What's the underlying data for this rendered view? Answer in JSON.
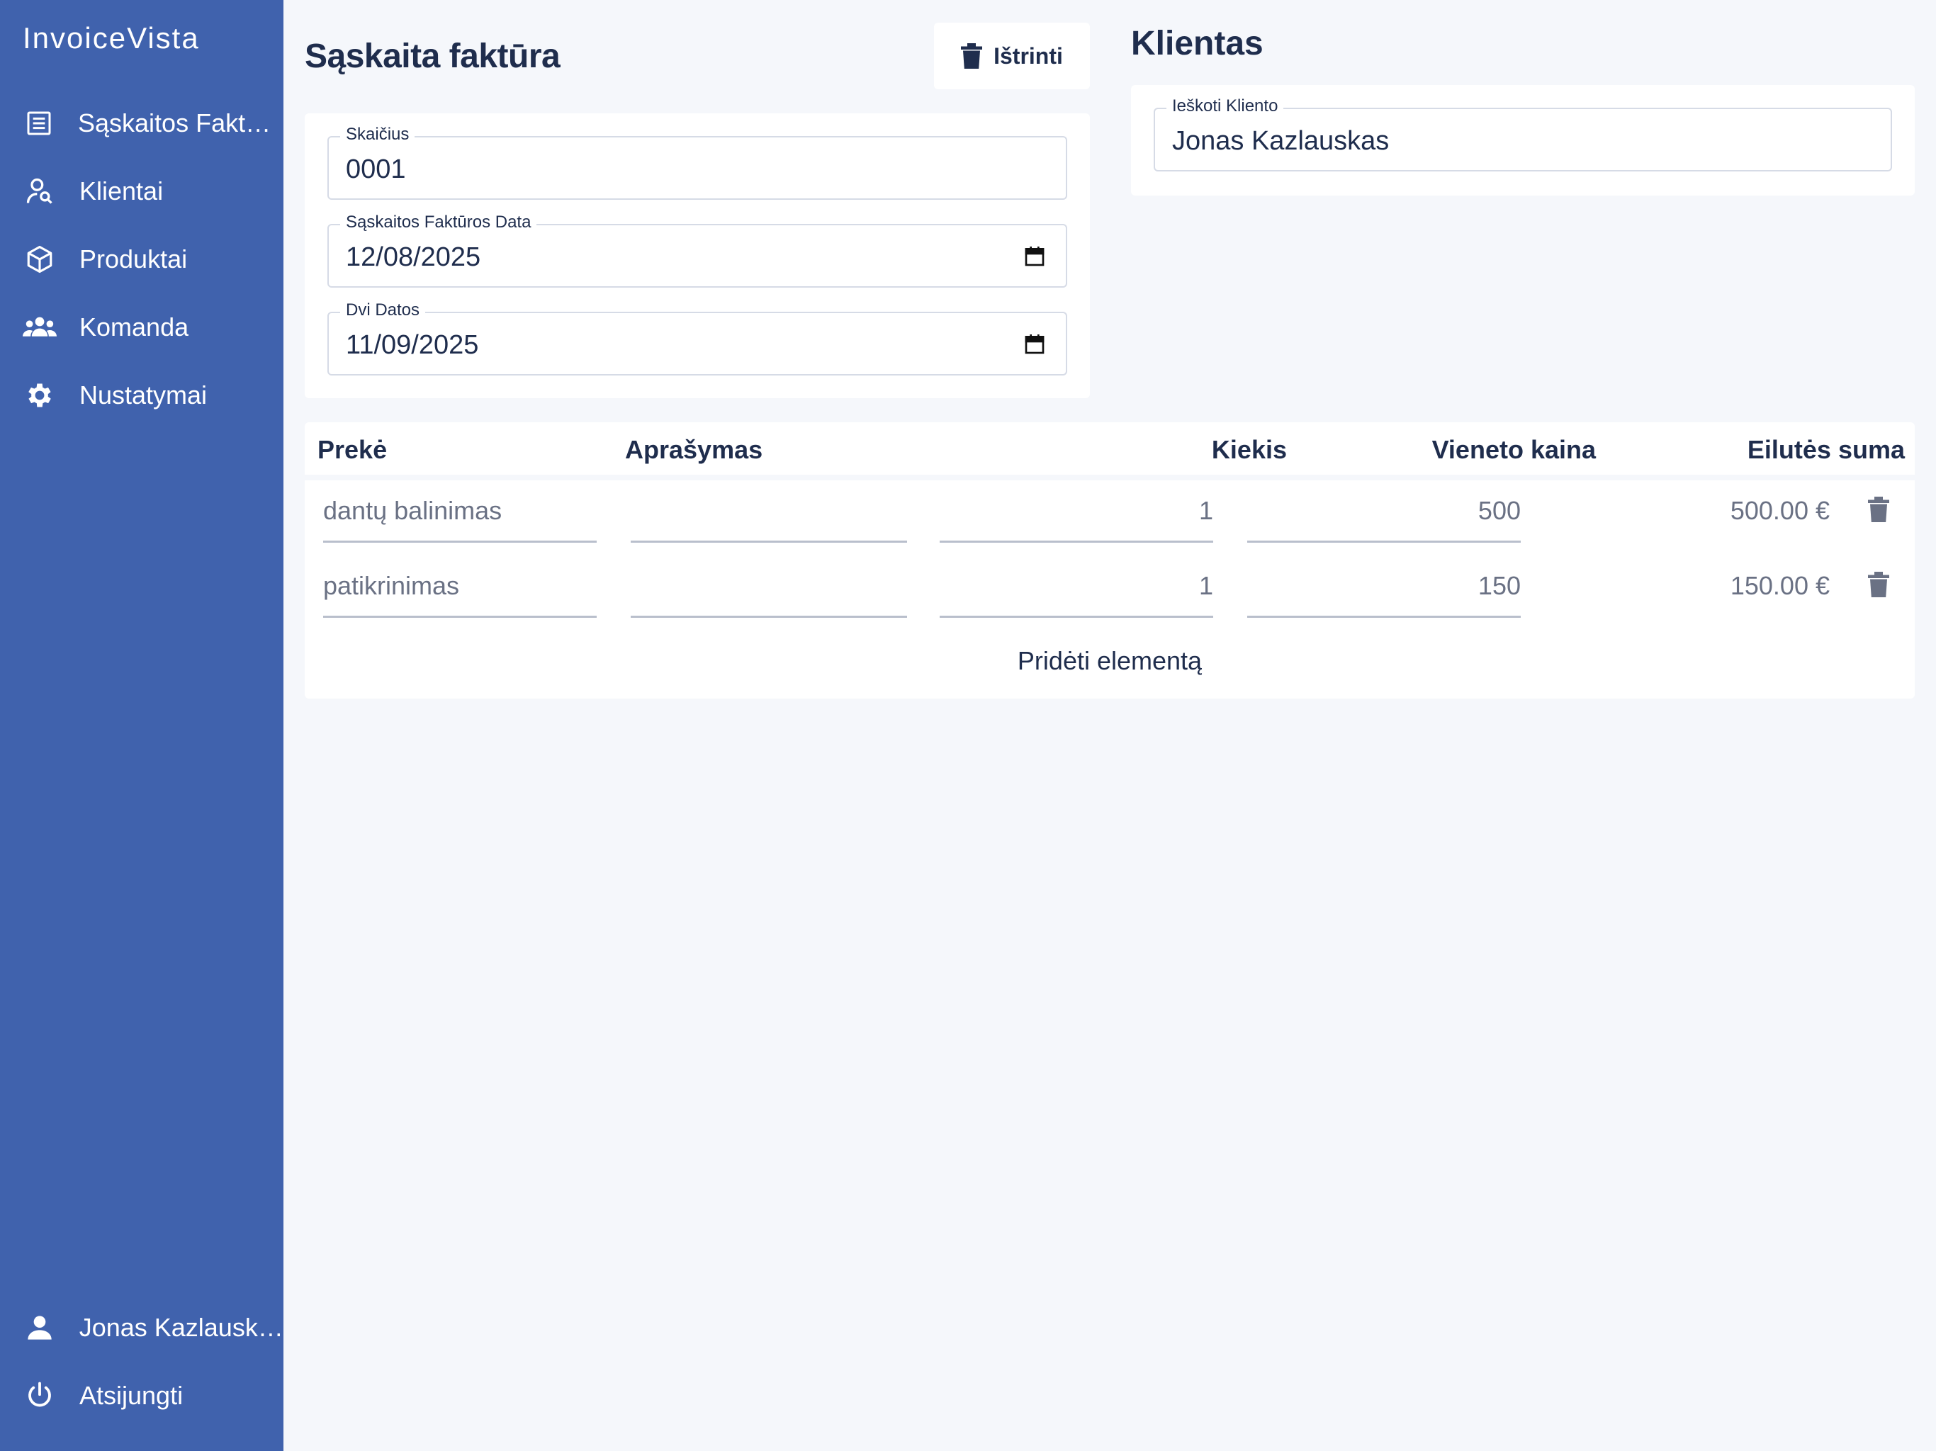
{
  "app": {
    "brand": "InvoiceVista"
  },
  "sidebar": {
    "items": [
      {
        "label": "Sąskaitos Faktūros",
        "icon": "receipt-icon"
      },
      {
        "label": "Klientai",
        "icon": "user-search-icon"
      },
      {
        "label": "Produktai",
        "icon": "cube-icon"
      },
      {
        "label": "Komanda",
        "icon": "users-icon"
      },
      {
        "label": "Nustatymai",
        "icon": "gear-icon"
      }
    ],
    "bottom": [
      {
        "label": "Jonas Kazlauskas",
        "icon": "user-icon"
      },
      {
        "label": "Atsijungti",
        "icon": "power-icon"
      }
    ]
  },
  "invoice": {
    "title": "Sąskaita faktūra",
    "delete_label": "Ištrinti",
    "number_label": "Skaičius",
    "number_value": "0001",
    "date_label": "Sąskaitos Faktūros Data",
    "date_value": "12/08/2025",
    "due_label": "Dvi Datos",
    "due_value": "11/09/2025"
  },
  "client": {
    "title": "Klientas",
    "search_label": "Ieškoti Kliento",
    "search_value": "Jonas Kazlauskas"
  },
  "items": {
    "headers": {
      "product": "Prekė",
      "description": "Aprašymas",
      "quantity": "Kiekis",
      "unit_price": "Vieneto kaina",
      "line_total": "Eilutės suma"
    },
    "rows": [
      {
        "product": "dantų balinimas",
        "description": "",
        "quantity": "1",
        "unit_price": "500",
        "line_total": "500.00 €"
      },
      {
        "product": "patikrinimas",
        "description": "",
        "quantity": "1",
        "unit_price": "150",
        "line_total": "150.00 €"
      }
    ],
    "add_label": "Pridėti elementą"
  },
  "colors": {
    "sidebar": "#4062ad",
    "background": "#f5f7fb",
    "text_dark": "#1f2d4d",
    "text_muted": "#6a7184"
  }
}
